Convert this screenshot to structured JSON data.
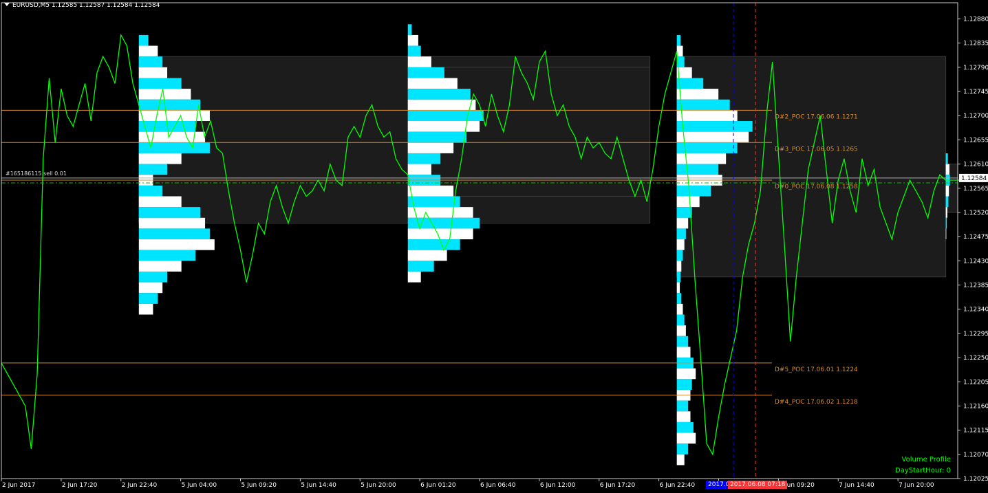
{
  "header": {
    "symbol_line": "EURUSD,M5  1.12585 1.12587 1.12584 1.12584"
  },
  "trade_label": "#165186115 sell 0.01",
  "indicator": {
    "name": "Volume Profile",
    "param": "DayStartHour: 0"
  },
  "markers": {
    "blue_label": "2017.0",
    "red_label": "2017.06.08 07:18"
  },
  "colors": {
    "background": "#000000",
    "price_line": "#00ff00",
    "profile_a": "#00e5ff",
    "profile_b": "#ffffff",
    "poc_line": "#d98c2b",
    "bid_line": "#b0b0b0",
    "blue_marker": "#0000ff",
    "red_marker": "#ff3333"
  },
  "chart_data": {
    "type": "line",
    "title": "",
    "ylim": [
      1.12025,
      1.1291
    ],
    "y_ticks": [
      1.1288,
      1.12835,
      1.1279,
      1.12745,
      1.127,
      1.12655,
      1.1261,
      1.12565,
      1.1252,
      1.12475,
      1.1243,
      1.12385,
      1.1234,
      1.12295,
      1.1225,
      1.12205,
      1.1216,
      1.12115,
      1.1207,
      1.12025
    ],
    "current_price": "1.12584",
    "x_ticks": [
      "2 Jun 2017",
      "2 Jun 17:20",
      "2 Jun 22:40",
      "5 Jun 04:00",
      "5 Jun 09:20",
      "5 Jun 14:40",
      "5 Jun 20:00",
      "6 Jun 01:20",
      "6 Jun 06:40",
      "6 Jun 12:00",
      "6 Jun 17:20",
      "6 Jun 22:40",
      "7 Jun 04:00",
      "7 Jun 09:20",
      "7 Jun 14:40",
      "7 Jun 20:00"
    ],
    "series": [
      {
        "x_index": [
          0,
          0.1,
          0.2,
          0.3,
          0.4,
          0.5,
          0.6,
          0.7,
          0.8,
          0.9,
          1.0,
          1.1,
          1.2,
          1.3,
          1.4,
          1.5,
          1.6,
          1.7,
          1.8,
          1.9,
          2.0,
          2.1,
          2.2,
          2.3,
          2.4,
          2.5,
          2.6,
          2.7,
          2.8,
          2.9,
          3.0,
          3.1,
          3.2,
          3.3,
          3.4,
          3.5,
          3.6,
          3.7,
          3.8,
          3.9,
          4.0,
          4.1,
          4.2,
          4.3,
          4.4,
          4.5,
          4.6,
          4.7,
          4.8,
          4.9,
          5.0,
          5.1,
          5.2,
          5.3,
          5.4,
          5.5,
          5.6,
          5.7,
          5.8,
          5.9,
          6.0,
          6.1,
          6.2,
          6.3,
          6.4,
          6.5,
          6.6,
          6.7,
          6.8,
          6.9,
          7.0,
          7.1,
          7.2,
          7.3,
          7.4,
          7.5,
          7.6,
          7.7,
          7.8,
          7.9,
          8.0,
          8.1,
          8.2,
          8.3,
          8.4,
          8.5,
          8.6,
          8.7,
          8.8,
          8.9,
          9.0,
          9.1,
          9.2,
          9.3,
          9.4,
          9.5,
          9.6,
          9.7,
          9.8,
          9.9,
          10.0,
          10.1,
          10.2,
          10.3,
          10.4,
          10.5,
          10.6,
          10.7,
          10.8,
          10.9,
          11.0,
          11.1,
          11.2,
          11.3,
          11.4,
          11.5,
          11.6,
          11.7,
          11.8,
          11.9,
          12.0,
          12.1,
          12.2,
          12.3,
          12.4,
          12.5,
          12.6,
          12.7,
          12.8,
          12.9,
          13.0,
          13.1,
          13.2,
          13.3,
          13.4,
          13.5,
          13.6,
          13.7,
          13.8,
          13.9,
          14.0,
          14.1,
          14.2,
          14.3,
          14.4,
          14.5,
          14.6,
          14.7,
          14.8,
          14.9,
          15.0,
          15.1,
          15.2,
          15.3,
          15.4,
          15.5,
          15.6,
          15.7,
          15.8,
          15.9,
          16.0,
          16.1,
          16.2,
          16.3
        ],
        "y": [
          1.1224,
          1.1222,
          1.122,
          1.1218,
          1.1216,
          1.1208,
          1.1222,
          1.1262,
          1.1277,
          1.1265,
          1.1275,
          1.127,
          1.1268,
          1.1272,
          1.1276,
          1.1269,
          1.1278,
          1.1281,
          1.1279,
          1.1276,
          1.1285,
          1.1283,
          1.1276,
          1.1272,
          1.1268,
          1.1264,
          1.127,
          1.1275,
          1.1266,
          1.1268,
          1.127,
          1.1266,
          1.1264,
          1.1272,
          1.1266,
          1.1269,
          1.1264,
          1.1263,
          1.1256,
          1.125,
          1.1245,
          1.1239,
          1.1244,
          1.125,
          1.1248,
          1.1254,
          1.1257,
          1.1253,
          1.125,
          1.1254,
          1.1257,
          1.1255,
          1.1256,
          1.1258,
          1.1256,
          1.1261,
          1.1258,
          1.1257,
          1.1266,
          1.1268,
          1.1266,
          1.127,
          1.1272,
          1.1268,
          1.1266,
          1.1267,
          1.1262,
          1.126,
          1.1259,
          1.1253,
          1.1249,
          1.1252,
          1.125,
          1.1248,
          1.1245,
          1.1247,
          1.1256,
          1.1262,
          1.127,
          1.1274,
          1.1272,
          1.1268,
          1.1274,
          1.127,
          1.1267,
          1.1272,
          1.1281,
          1.1278,
          1.1276,
          1.1273,
          1.128,
          1.1282,
          1.1274,
          1.127,
          1.1272,
          1.1268,
          1.1266,
          1.1262,
          1.1266,
          1.1264,
          1.1265,
          1.1263,
          1.1262,
          1.1266,
          1.1262,
          1.1258,
          1.1255,
          1.1258,
          1.1254,
          1.126,
          1.1268,
          1.1274,
          1.1278,
          1.1282,
          1.1268,
          1.1257,
          1.124,
          1.1225,
          1.1209,
          1.1207,
          1.1214,
          1.122,
          1.1225,
          1.123,
          1.124,
          1.1246,
          1.125,
          1.1256,
          1.127,
          1.128,
          1.1263,
          1.1246,
          1.1228,
          1.124,
          1.125,
          1.126,
          1.1265,
          1.127,
          1.126,
          1.125,
          1.1258,
          1.1262,
          1.1256,
          1.1252,
          1.1262,
          1.1257,
          1.126,
          1.1253,
          1.125,
          1.1247,
          1.1252,
          1.1255,
          1.1258,
          1.1256,
          1.1254,
          1.1251,
          1.1256,
          1.1259,
          1.1258,
          1.1258,
          1.1258,
          1.1258
        ]
      }
    ],
    "poc_lines": [
      {
        "label": "D#2_POC 17.06.06 1.1271",
        "value": 1.1271
      },
      {
        "label": "D#3_POC 17.06.05 1.1265",
        "value": 1.1265
      },
      {
        "label": "D#0_POC 17.06.08 1.1258",
        "value": 1.1258
      },
      {
        "label": "D#5_POC 17.06.01 1.1224",
        "value": 1.1224
      },
      {
        "label": "D#4_POC 17.06.02 1.1218",
        "value": 1.1218
      }
    ],
    "trade_line": 1.12575,
    "volume_profiles": [
      {
        "x_start": 2.3,
        "x_end": 10.85,
        "va_low": 1.125,
        "va_high": 1.1281,
        "levels": [
          1.1284,
          1.1282,
          1.128,
          1.1278,
          1.1276,
          1.1274,
          1.1272,
          1.127,
          1.1268,
          1.1266,
          1.1264,
          1.1262,
          1.126,
          1.1258,
          1.1256,
          1.1254,
          1.1252,
          1.125,
          1.1248,
          1.1246,
          1.1244,
          1.1242,
          1.124,
          1.1238,
          1.1236,
          1.1234
        ],
        "volumes": [
          10,
          20,
          25,
          30,
          45,
          55,
          65,
          75,
          60,
          70,
          75,
          45,
          30,
          15,
          25,
          45,
          65,
          70,
          75,
          80,
          60,
          45,
          30,
          25,
          20,
          15
        ]
      },
      {
        "x_start": 6.8,
        "x_end": 10.85,
        "va_low": 1.1255,
        "va_high": 1.1279,
        "levels": [
          1.1286,
          1.1284,
          1.1282,
          1.128,
          1.1278,
          1.1276,
          1.1274,
          1.1272,
          1.127,
          1.1268,
          1.1266,
          1.1264,
          1.1262,
          1.126,
          1.1258,
          1.1256,
          1.1254,
          1.1252,
          1.125,
          1.1248,
          1.1246,
          1.1244,
          1.1242,
          1.124
        ],
        "volumes": [
          3,
          8,
          10,
          18,
          28,
          38,
          48,
          52,
          58,
          55,
          45,
          35,
          25,
          18,
          25,
          35,
          40,
          50,
          55,
          50,
          40,
          30,
          20,
          10
        ]
      },
      {
        "x_start": 11.3,
        "x_end": 15.8,
        "va_low": 1.124,
        "va_high": 1.1281,
        "levels": [
          1.1284,
          1.1282,
          1.128,
          1.1278,
          1.1276,
          1.1274,
          1.1272,
          1.127,
          1.1268,
          1.1266,
          1.1264,
          1.1262,
          1.126,
          1.1258,
          1.1256,
          1.1254,
          1.1252,
          1.125,
          1.1248,
          1.1246,
          1.1244,
          1.1242,
          1.124,
          1.1238,
          1.1236,
          1.1234,
          1.1232,
          1.123,
          1.1228,
          1.1226,
          1.1224,
          1.1222,
          1.122,
          1.1218,
          1.1216,
          1.1214,
          1.1212,
          1.121,
          1.1208,
          1.1206
        ],
        "volumes": [
          5,
          8,
          10,
          20,
          35,
          55,
          70,
          80,
          100,
          95,
          80,
          65,
          55,
          60,
          45,
          30,
          20,
          15,
          12,
          10,
          8,
          6,
          5,
          4,
          6,
          8,
          10,
          12,
          15,
          18,
          22,
          25,
          20,
          18,
          15,
          18,
          22,
          25,
          15,
          10
        ]
      },
      {
        "x_start": 15.8,
        "x_end": 17.5,
        "va_low": 1.1252,
        "va_high": 1.1261,
        "levels": [
          1.1262,
          1.126,
          1.1258,
          1.1256,
          1.1254,
          1.1252,
          1.125,
          1.1248
        ],
        "volumes": [
          20,
          35,
          40,
          30,
          25,
          15,
          10,
          5
        ]
      }
    ]
  }
}
